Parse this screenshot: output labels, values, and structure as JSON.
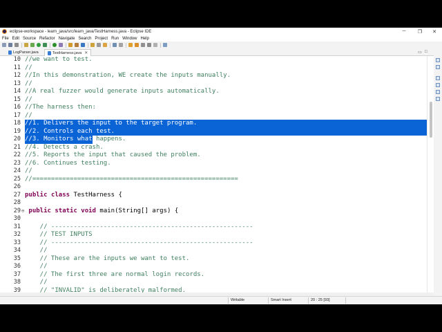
{
  "window": {
    "title": "eclipse-workspace - learn_java/src/learn_java/TestHarness.java - Eclipse IDE",
    "minimize": "─",
    "restore": "❐",
    "close": "✕"
  },
  "menu": [
    "File",
    "Edit",
    "Source",
    "Refactor",
    "Navigate",
    "Search",
    "Project",
    "Run",
    "Window",
    "Help"
  ],
  "tabs": [
    {
      "label": "LogParser.java",
      "active": false
    },
    {
      "label": "TestHarness.java",
      "active": true
    }
  ],
  "tab_close": "✕",
  "tab_minimize": "▭",
  "tab_maximize": "□",
  "editor": {
    "lines": [
      {
        "n": "10",
        "text": "//we want to test."
      },
      {
        "n": "11",
        "text": "//"
      },
      {
        "n": "12",
        "text": "//In this demonstration, WE create the inputs manually."
      },
      {
        "n": "13",
        "text": "//"
      },
      {
        "n": "14",
        "text": "//A real fuzzer would generate inputs automatically."
      },
      {
        "n": "15",
        "text": "//"
      },
      {
        "n": "16",
        "text": "//The harness then:"
      },
      {
        "n": "17",
        "text": "//"
      },
      {
        "n": "18",
        "text": "//1. Delivers the input to the target program."
      },
      {
        "n": "19",
        "text": "//2. Controls each test."
      },
      {
        "n": "20",
        "text": "//3. Monitors what happens."
      },
      {
        "n": "21",
        "text": "//4. Detects a crash."
      },
      {
        "n": "22",
        "text": "//5. Reports the input that caused the problem."
      },
      {
        "n": "23",
        "text": "//6. Continues testing."
      },
      {
        "n": "24",
        "text": "//"
      },
      {
        "n": "25",
        "text": "//======================================================="
      },
      {
        "n": "26",
        "text": ""
      },
      {
        "n": "27",
        "text": "public class TestHarness {"
      },
      {
        "n": "28",
        "text": ""
      },
      {
        "n": "29",
        "text": " public static void main(String[] args) {",
        "marker": "⊖"
      },
      {
        "n": "30",
        "text": ""
      },
      {
        "n": "31",
        "text": "    // ------------------------------------------------------"
      },
      {
        "n": "32",
        "text": "    // TEST INPUTS"
      },
      {
        "n": "33",
        "text": "    // ------------------------------------------------------"
      },
      {
        "n": "34",
        "text": "    //"
      },
      {
        "n": "35",
        "text": "    // These are the inputs we want to test."
      },
      {
        "n": "36",
        "text": "    //"
      },
      {
        "n": "37",
        "text": "    // The first three are normal login records."
      },
      {
        "n": "38",
        "text": "    //"
      },
      {
        "n": "39",
        "text": "    // \"INVALID\" is deliberately malformed."
      }
    ]
  },
  "status": {
    "writable": "Writable",
    "insert_mode": "Smart Insert",
    "position": "20 : 25 [93]"
  }
}
